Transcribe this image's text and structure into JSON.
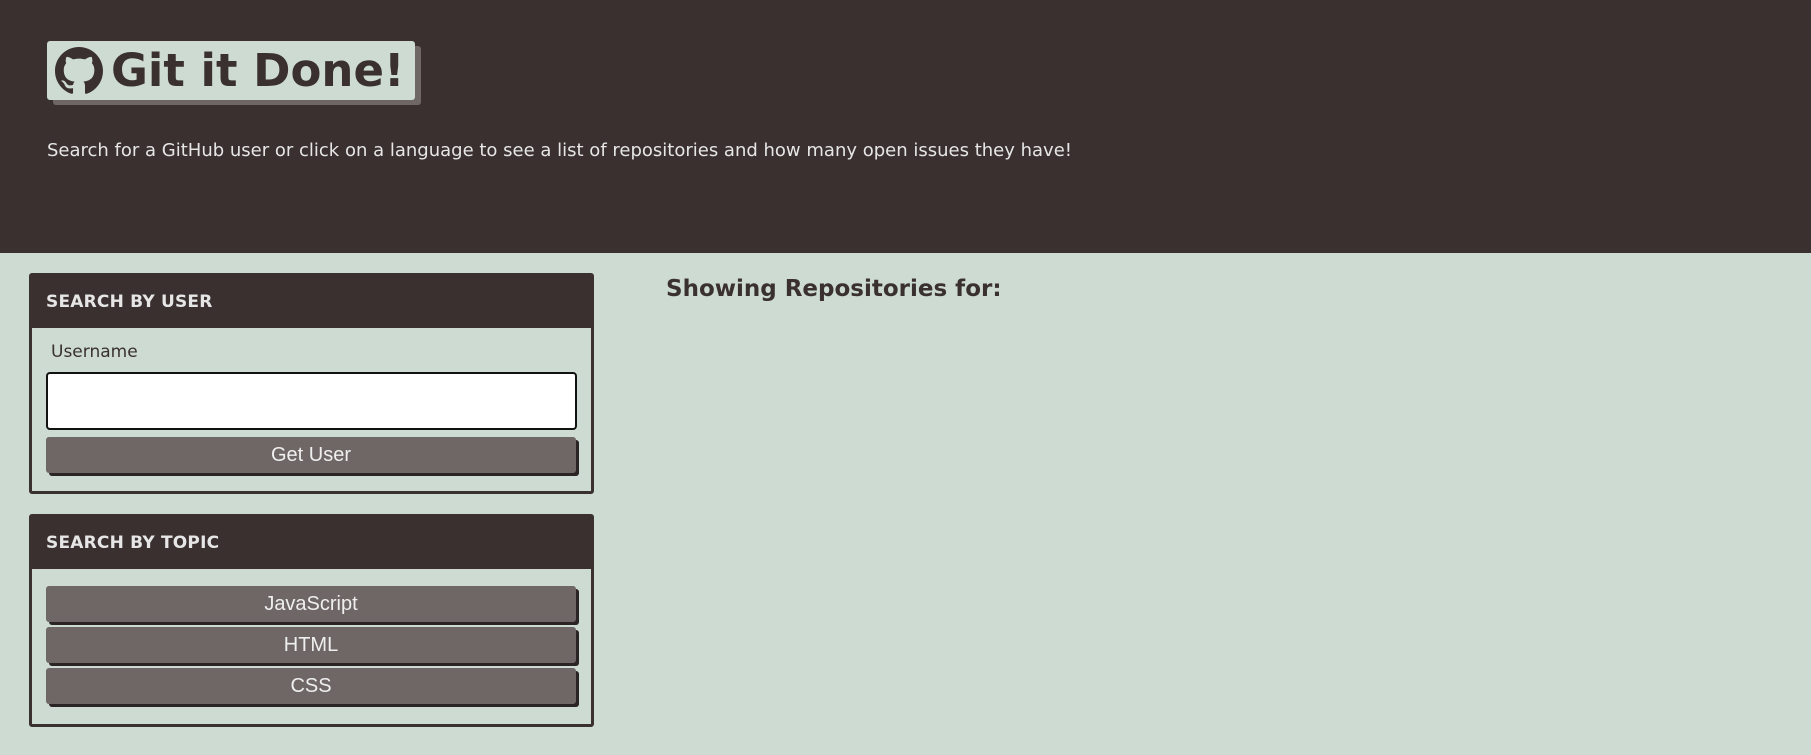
{
  "header": {
    "title": "Git it Done!",
    "subtitle": "Search for a GitHub user or click on a language to see a list of repositories and how many open issues they have!",
    "icon": "github-octocat-icon"
  },
  "search_user": {
    "heading": "SEARCH BY USER",
    "username_label": "Username",
    "username_value": "",
    "username_placeholder": "",
    "button_label": "Get User"
  },
  "search_topic": {
    "heading": "SEARCH BY TOPIC",
    "languages": [
      "JavaScript",
      "HTML",
      "CSS"
    ]
  },
  "results": {
    "heading": "Showing Repositories for:"
  },
  "colors": {
    "header_bg": "#3a3030",
    "page_bg": "#cddbd2",
    "button_bg": "#6e6766",
    "text_light": "#e6e6e6"
  }
}
